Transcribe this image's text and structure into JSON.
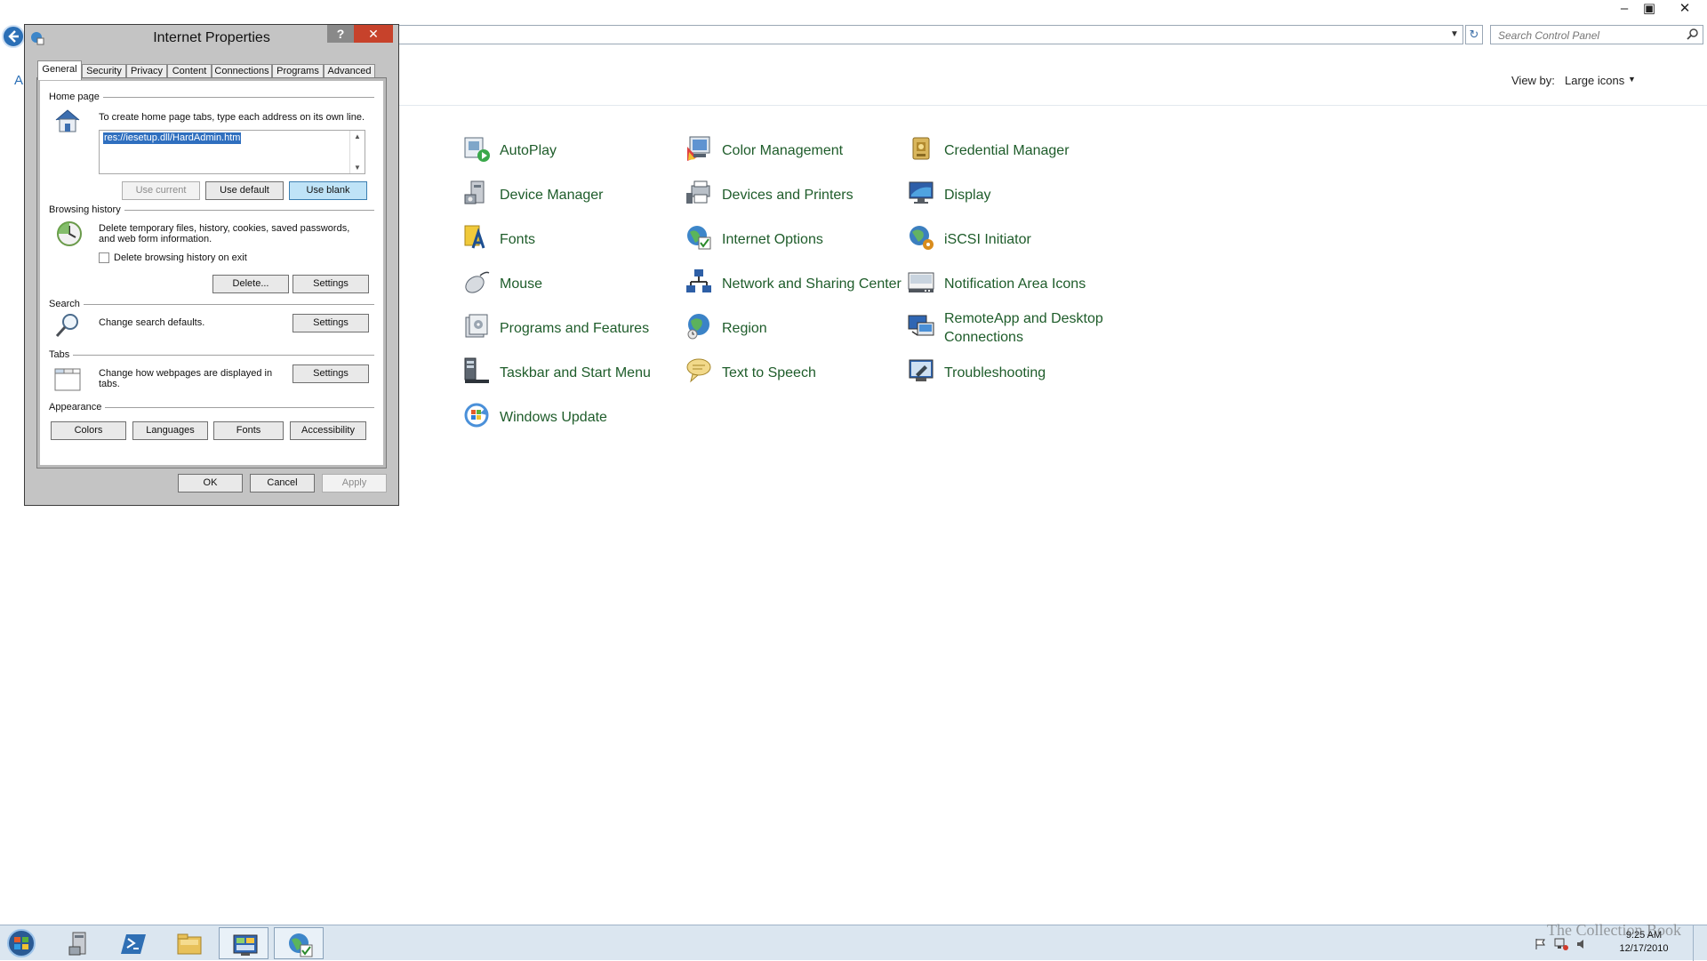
{
  "control_panel": {
    "window_controls": {
      "minimize": "–",
      "maximize": "▣",
      "close": "✕"
    },
    "search": {
      "placeholder": "Search Control Panel"
    },
    "view_by": {
      "label": "View by:",
      "value": "Large icons"
    },
    "left_clip_text": "A",
    "items": [
      {
        "label": "AutoPlay",
        "icon": "autoplay-icon"
      },
      {
        "label": "Color Management",
        "icon": "color-management-icon"
      },
      {
        "label": "Credential Manager",
        "icon": "credential-manager-icon"
      },
      {
        "label": "Device Manager",
        "icon": "device-manager-icon"
      },
      {
        "label": "Devices and Printers",
        "icon": "devices-printers-icon"
      },
      {
        "label": "Display",
        "icon": "display-icon"
      },
      {
        "label": "Fonts",
        "icon": "fonts-icon"
      },
      {
        "label": "Internet Options",
        "icon": "internet-options-icon"
      },
      {
        "label": "iSCSI Initiator",
        "icon": "iscsi-initiator-icon"
      },
      {
        "label": "Mouse",
        "icon": "mouse-icon"
      },
      {
        "label": "Network and Sharing Center",
        "icon": "network-sharing-icon"
      },
      {
        "label": "Notification Area Icons",
        "icon": "notification-area-icon"
      },
      {
        "label": "Programs and Features",
        "icon": "programs-features-icon"
      },
      {
        "label": "Region",
        "icon": "region-icon"
      },
      {
        "label": "RemoteApp and Desktop Connections",
        "icon": "remoteapp-icon"
      },
      {
        "label": "Taskbar and Start Menu",
        "icon": "taskbar-start-icon"
      },
      {
        "label": "Text to Speech",
        "icon": "text-to-speech-icon"
      },
      {
        "label": "Troubleshooting",
        "icon": "troubleshooting-icon"
      },
      {
        "label": "Windows Update",
        "icon": "windows-update-icon"
      }
    ]
  },
  "dialog": {
    "title": "Internet Properties",
    "help": "?",
    "close": "✕",
    "tabs": [
      "General",
      "Security",
      "Privacy",
      "Content",
      "Connections",
      "Programs",
      "Advanced"
    ],
    "home_page": {
      "heading": "Home page",
      "instruction": "To create home page tabs, type each address on its own line.",
      "value": "res://iesetup.dll/HardAdmin.htm",
      "use_current": "Use current",
      "use_default": "Use default",
      "use_blank": "Use blank"
    },
    "browsing_history": {
      "heading": "Browsing history",
      "description_line1": "Delete temporary files, history, cookies, saved passwords,",
      "description_line2": "and web form information.",
      "delete_on_exit": "Delete browsing history on exit",
      "delete": "Delete...",
      "settings": "Settings"
    },
    "search": {
      "heading": "Search",
      "description": "Change search defaults.",
      "settings": "Settings"
    },
    "tabs_section": {
      "heading": "Tabs",
      "description_line1": "Change how webpages are displayed in",
      "description_line2": "tabs.",
      "settings": "Settings"
    },
    "appearance": {
      "heading": "Appearance",
      "colors": "Colors",
      "languages": "Languages",
      "fonts": "Fonts",
      "accessibility": "Accessibility"
    },
    "ok": "OK",
    "cancel": "Cancel",
    "apply": "Apply"
  },
  "taskbar": {
    "clock_time": "9:25 AM",
    "clock_date": "12/17/2010",
    "watermark": "The Collection Book"
  }
}
